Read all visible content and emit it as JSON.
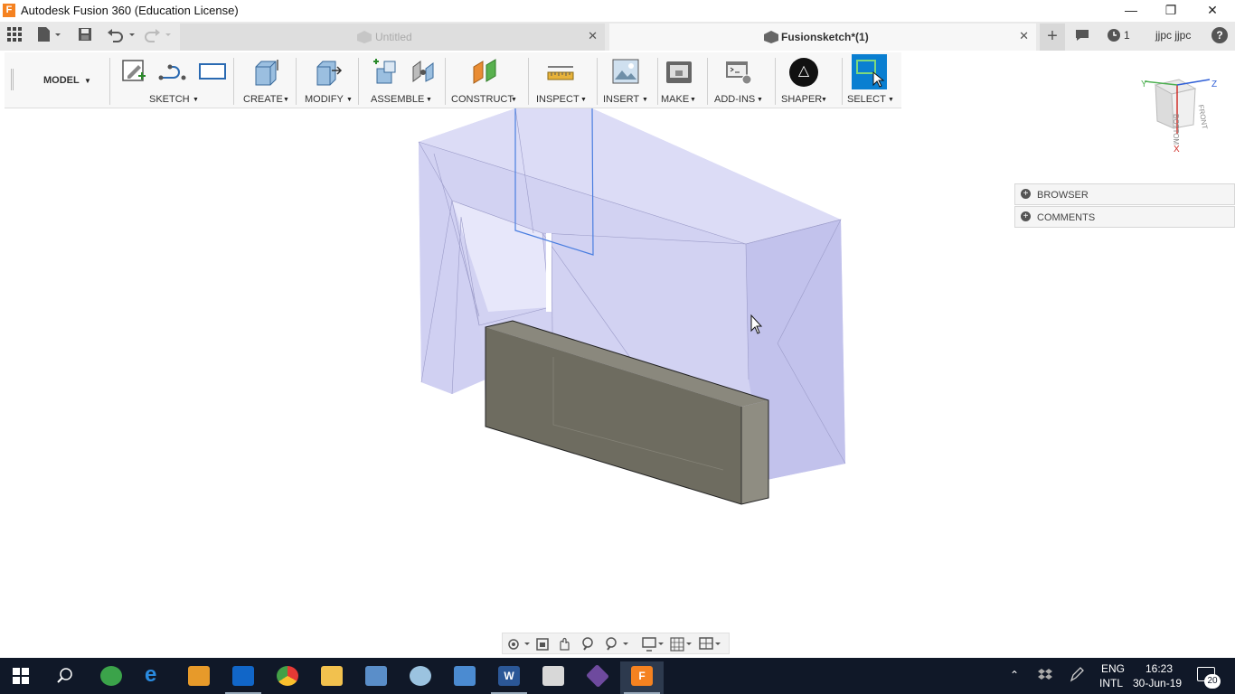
{
  "window": {
    "title": "Autodesk Fusion 360 (Education License)",
    "logo_letter": "F",
    "controls": {
      "minimize": "—",
      "restore": "❐",
      "close": "✕"
    }
  },
  "tabs": {
    "untitled": {
      "label": "Untitled",
      "close": "✕"
    },
    "active": {
      "label": "Fusionsketch*(1)",
      "close": "✕"
    },
    "new_tab": "+",
    "job_count": "1",
    "user": "jjpc jjpc",
    "help": "?"
  },
  "toolbar": {
    "workspace": "MODEL",
    "groups": {
      "sketch": "SKETCH",
      "create": "CREATE",
      "modify": "MODIFY",
      "assemble": "ASSEMBLE",
      "construct": "CONSTRUCT",
      "inspect": "INSPECT",
      "insert": "INSERT",
      "make": "MAKE",
      "addins": "ADD-INS",
      "shaper": "SHAPER",
      "select": "SELECT"
    }
  },
  "viewcube": {
    "top": "BOTTOM",
    "front": "FRONT",
    "x": "X",
    "y": "Y",
    "z": "Z"
  },
  "panels": {
    "browser": "BROWSER",
    "comments": "COMMENTS"
  },
  "taskbar": {
    "lang": "ENG",
    "layout": "INTL",
    "time": "16:23",
    "date": "30-Jun-19",
    "notifications": "20"
  },
  "colors": {
    "accent": "#0a7fd1",
    "logo": "#f58220",
    "taskbar": "#101828",
    "body_translucent": "#c9c9f0",
    "box_dark": "#6e6c60"
  }
}
